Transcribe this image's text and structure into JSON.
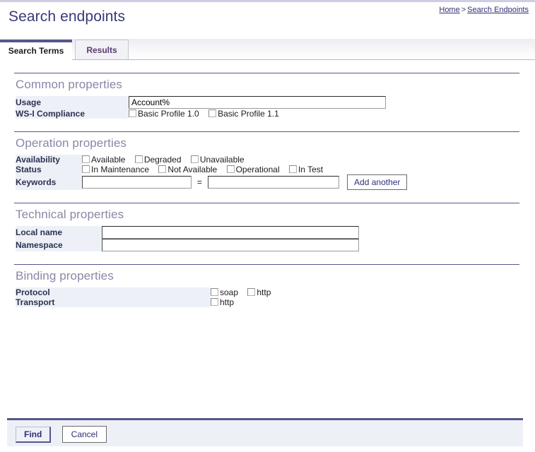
{
  "page": {
    "title": "Search endpoints"
  },
  "breadcrumb": {
    "home": "Home",
    "separator": ">",
    "current": "Search Endpoints"
  },
  "tabs": [
    {
      "label": "Search Terms",
      "active": true
    },
    {
      "label": "Results",
      "active": false
    }
  ],
  "sections": {
    "common": {
      "title": "Common properties",
      "usage_label": "Usage",
      "usage_value": "Account%",
      "usage_placeholder": "",
      "wsi_label": "WS-I Compliance",
      "wsi_options": [
        "Basic Profile 1.0",
        "Basic Profile 1.1"
      ]
    },
    "operation": {
      "title": "Operation properties",
      "availability_label": "Availability",
      "availability_options": [
        "Available",
        "Degraded",
        "Unavailable"
      ],
      "status_label": "Status",
      "status_options": [
        "In Maintenance",
        "Not Available",
        "Operational",
        "In Test"
      ],
      "keywords_label": "Keywords",
      "keyword_name_value": "",
      "keyword_equals": "=",
      "keyword_value_value": "",
      "add_another_label": "Add another"
    },
    "technical": {
      "title": "Technical properties",
      "local_name_label": "Local name",
      "local_name_value": "",
      "namespace_label": "Namespace",
      "namespace_value": ""
    },
    "binding": {
      "title": "Binding properties",
      "protocol_label": "Protocol",
      "protocol_options": [
        "soap",
        "http"
      ],
      "transport_label": "Transport",
      "transport_options": [
        "http"
      ]
    }
  },
  "footer": {
    "find_label": "Find",
    "cancel_label": "Cancel"
  },
  "colors": {
    "accent": "#56568c",
    "title": "#39387a",
    "section_title": "#8888a8",
    "label_cell": "#edf1f7",
    "link": "#2f2f77",
    "inactive_tab_text": "#5b3a74"
  }
}
